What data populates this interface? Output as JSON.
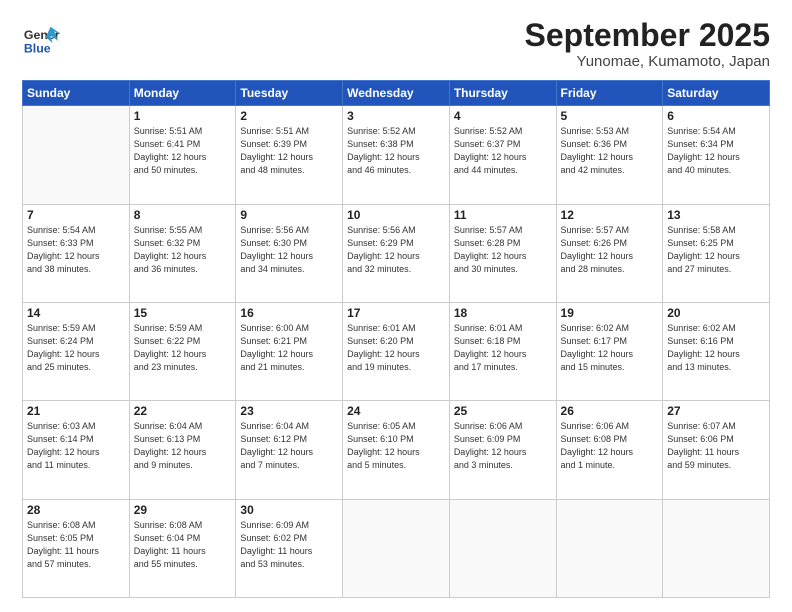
{
  "header": {
    "logo": {
      "line1": "General",
      "line2": "Blue"
    },
    "title": "September 2025",
    "subtitle": "Yunomae, Kumamoto, Japan"
  },
  "days_of_week": [
    "Sunday",
    "Monday",
    "Tuesday",
    "Wednesday",
    "Thursday",
    "Friday",
    "Saturday"
  ],
  "weeks": [
    [
      {
        "day": "",
        "info": ""
      },
      {
        "day": "1",
        "info": "Sunrise: 5:51 AM\nSunset: 6:41 PM\nDaylight: 12 hours\nand 50 minutes."
      },
      {
        "day": "2",
        "info": "Sunrise: 5:51 AM\nSunset: 6:39 PM\nDaylight: 12 hours\nand 48 minutes."
      },
      {
        "day": "3",
        "info": "Sunrise: 5:52 AM\nSunset: 6:38 PM\nDaylight: 12 hours\nand 46 minutes."
      },
      {
        "day": "4",
        "info": "Sunrise: 5:52 AM\nSunset: 6:37 PM\nDaylight: 12 hours\nand 44 minutes."
      },
      {
        "day": "5",
        "info": "Sunrise: 5:53 AM\nSunset: 6:36 PM\nDaylight: 12 hours\nand 42 minutes."
      },
      {
        "day": "6",
        "info": "Sunrise: 5:54 AM\nSunset: 6:34 PM\nDaylight: 12 hours\nand 40 minutes."
      }
    ],
    [
      {
        "day": "7",
        "info": "Sunrise: 5:54 AM\nSunset: 6:33 PM\nDaylight: 12 hours\nand 38 minutes."
      },
      {
        "day": "8",
        "info": "Sunrise: 5:55 AM\nSunset: 6:32 PM\nDaylight: 12 hours\nand 36 minutes."
      },
      {
        "day": "9",
        "info": "Sunrise: 5:56 AM\nSunset: 6:30 PM\nDaylight: 12 hours\nand 34 minutes."
      },
      {
        "day": "10",
        "info": "Sunrise: 5:56 AM\nSunset: 6:29 PM\nDaylight: 12 hours\nand 32 minutes."
      },
      {
        "day": "11",
        "info": "Sunrise: 5:57 AM\nSunset: 6:28 PM\nDaylight: 12 hours\nand 30 minutes."
      },
      {
        "day": "12",
        "info": "Sunrise: 5:57 AM\nSunset: 6:26 PM\nDaylight: 12 hours\nand 28 minutes."
      },
      {
        "day": "13",
        "info": "Sunrise: 5:58 AM\nSunset: 6:25 PM\nDaylight: 12 hours\nand 27 minutes."
      }
    ],
    [
      {
        "day": "14",
        "info": "Sunrise: 5:59 AM\nSunset: 6:24 PM\nDaylight: 12 hours\nand 25 minutes."
      },
      {
        "day": "15",
        "info": "Sunrise: 5:59 AM\nSunset: 6:22 PM\nDaylight: 12 hours\nand 23 minutes."
      },
      {
        "day": "16",
        "info": "Sunrise: 6:00 AM\nSunset: 6:21 PM\nDaylight: 12 hours\nand 21 minutes."
      },
      {
        "day": "17",
        "info": "Sunrise: 6:01 AM\nSunset: 6:20 PM\nDaylight: 12 hours\nand 19 minutes."
      },
      {
        "day": "18",
        "info": "Sunrise: 6:01 AM\nSunset: 6:18 PM\nDaylight: 12 hours\nand 17 minutes."
      },
      {
        "day": "19",
        "info": "Sunrise: 6:02 AM\nSunset: 6:17 PM\nDaylight: 12 hours\nand 15 minutes."
      },
      {
        "day": "20",
        "info": "Sunrise: 6:02 AM\nSunset: 6:16 PM\nDaylight: 12 hours\nand 13 minutes."
      }
    ],
    [
      {
        "day": "21",
        "info": "Sunrise: 6:03 AM\nSunset: 6:14 PM\nDaylight: 12 hours\nand 11 minutes."
      },
      {
        "day": "22",
        "info": "Sunrise: 6:04 AM\nSunset: 6:13 PM\nDaylight: 12 hours\nand 9 minutes."
      },
      {
        "day": "23",
        "info": "Sunrise: 6:04 AM\nSunset: 6:12 PM\nDaylight: 12 hours\nand 7 minutes."
      },
      {
        "day": "24",
        "info": "Sunrise: 6:05 AM\nSunset: 6:10 PM\nDaylight: 12 hours\nand 5 minutes."
      },
      {
        "day": "25",
        "info": "Sunrise: 6:06 AM\nSunset: 6:09 PM\nDaylight: 12 hours\nand 3 minutes."
      },
      {
        "day": "26",
        "info": "Sunrise: 6:06 AM\nSunset: 6:08 PM\nDaylight: 12 hours\nand 1 minute."
      },
      {
        "day": "27",
        "info": "Sunrise: 6:07 AM\nSunset: 6:06 PM\nDaylight: 11 hours\nand 59 minutes."
      }
    ],
    [
      {
        "day": "28",
        "info": "Sunrise: 6:08 AM\nSunset: 6:05 PM\nDaylight: 11 hours\nand 57 minutes."
      },
      {
        "day": "29",
        "info": "Sunrise: 6:08 AM\nSunset: 6:04 PM\nDaylight: 11 hours\nand 55 minutes."
      },
      {
        "day": "30",
        "info": "Sunrise: 6:09 AM\nSunset: 6:02 PM\nDaylight: 11 hours\nand 53 minutes."
      },
      {
        "day": "",
        "info": ""
      },
      {
        "day": "",
        "info": ""
      },
      {
        "day": "",
        "info": ""
      },
      {
        "day": "",
        "info": ""
      }
    ]
  ]
}
